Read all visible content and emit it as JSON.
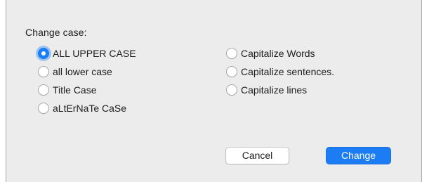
{
  "dialog": {
    "heading": "Change case:",
    "options_left": [
      {
        "label": "ALL UPPER CASE",
        "selected": true
      },
      {
        "label": "all lower case",
        "selected": false
      },
      {
        "label": "Title Case",
        "selected": false
      },
      {
        "label": "aLtErNaTe CaSe",
        "selected": false
      }
    ],
    "options_right": [
      {
        "label": "Capitalize Words",
        "selected": false
      },
      {
        "label": "Capitalize sentences.",
        "selected": false
      },
      {
        "label": "Capitalize lines",
        "selected": false
      }
    ],
    "buttons": {
      "cancel_label": "Cancel",
      "change_label": "Change"
    }
  },
  "colors": {
    "accent": "#1a7ef5",
    "dialog_background": "#ececec"
  }
}
